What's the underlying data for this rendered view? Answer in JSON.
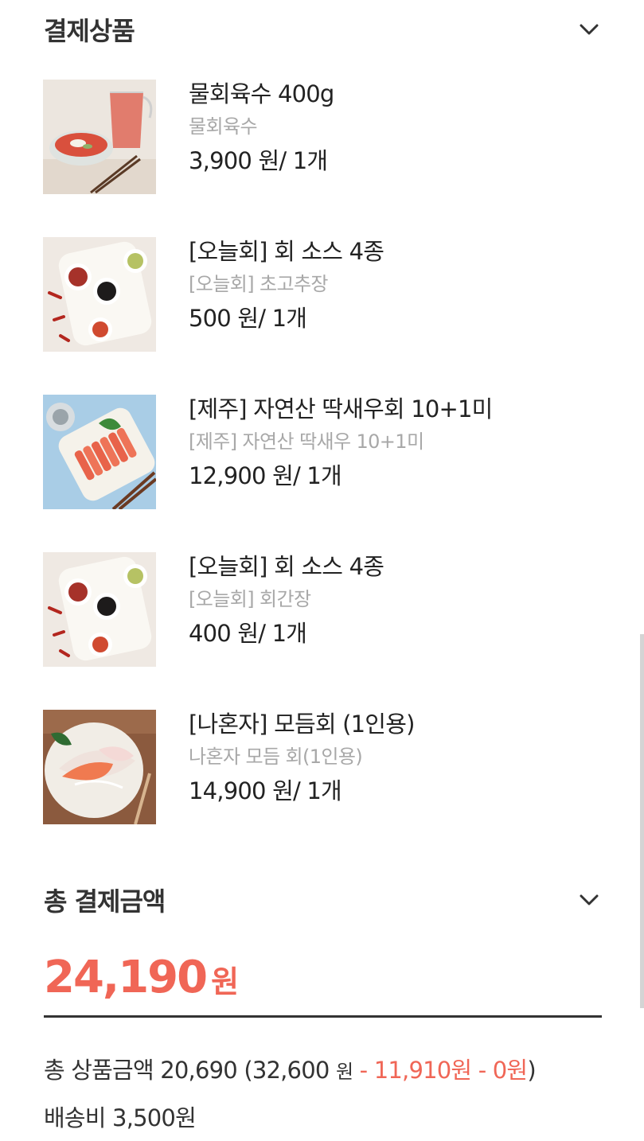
{
  "payment_products": {
    "title": "결제상품",
    "items": [
      {
        "name": "물회육수 400g",
        "option": "물회육수",
        "price": "3,900 원/ 1개",
        "image": "soup-bowl-juice-photo"
      },
      {
        "name": "[오늘회] 회 소스 4종",
        "option": "[오늘회] 초고추장",
        "price": "500 원/ 1개",
        "image": "sauce-dishes-photo"
      },
      {
        "name": "[제주] 자연산 딱새우회 10+1미",
        "option": "[제주] 자연산 딱새우 10+1미",
        "price": "12,900 원/ 1개",
        "image": "shrimp-sashimi-photo"
      },
      {
        "name": "[오늘회] 회 소스 4종",
        "option": "[오늘회] 회간장",
        "price": "400 원/ 1개",
        "image": "sauce-dishes-photo"
      },
      {
        "name": "[나혼자] 모듬회 (1인용)",
        "option": "나혼자 모듬 회(1인용)",
        "price": "14,900 원/ 1개",
        "image": "assorted-sashimi-photo"
      }
    ]
  },
  "total_payment": {
    "title": "총 결제금액",
    "amount": "24,190",
    "unit": "원",
    "breakdown": {
      "label": "총 상품금액 20,690 (32,600",
      "won1": "원",
      "discount": " - 11,910원 - 0원",
      "close": ")"
    },
    "shipping": "배송비 3,500원"
  },
  "colors": {
    "accent": "#f06656",
    "text": "#222222",
    "muted": "#a8a8a8"
  }
}
